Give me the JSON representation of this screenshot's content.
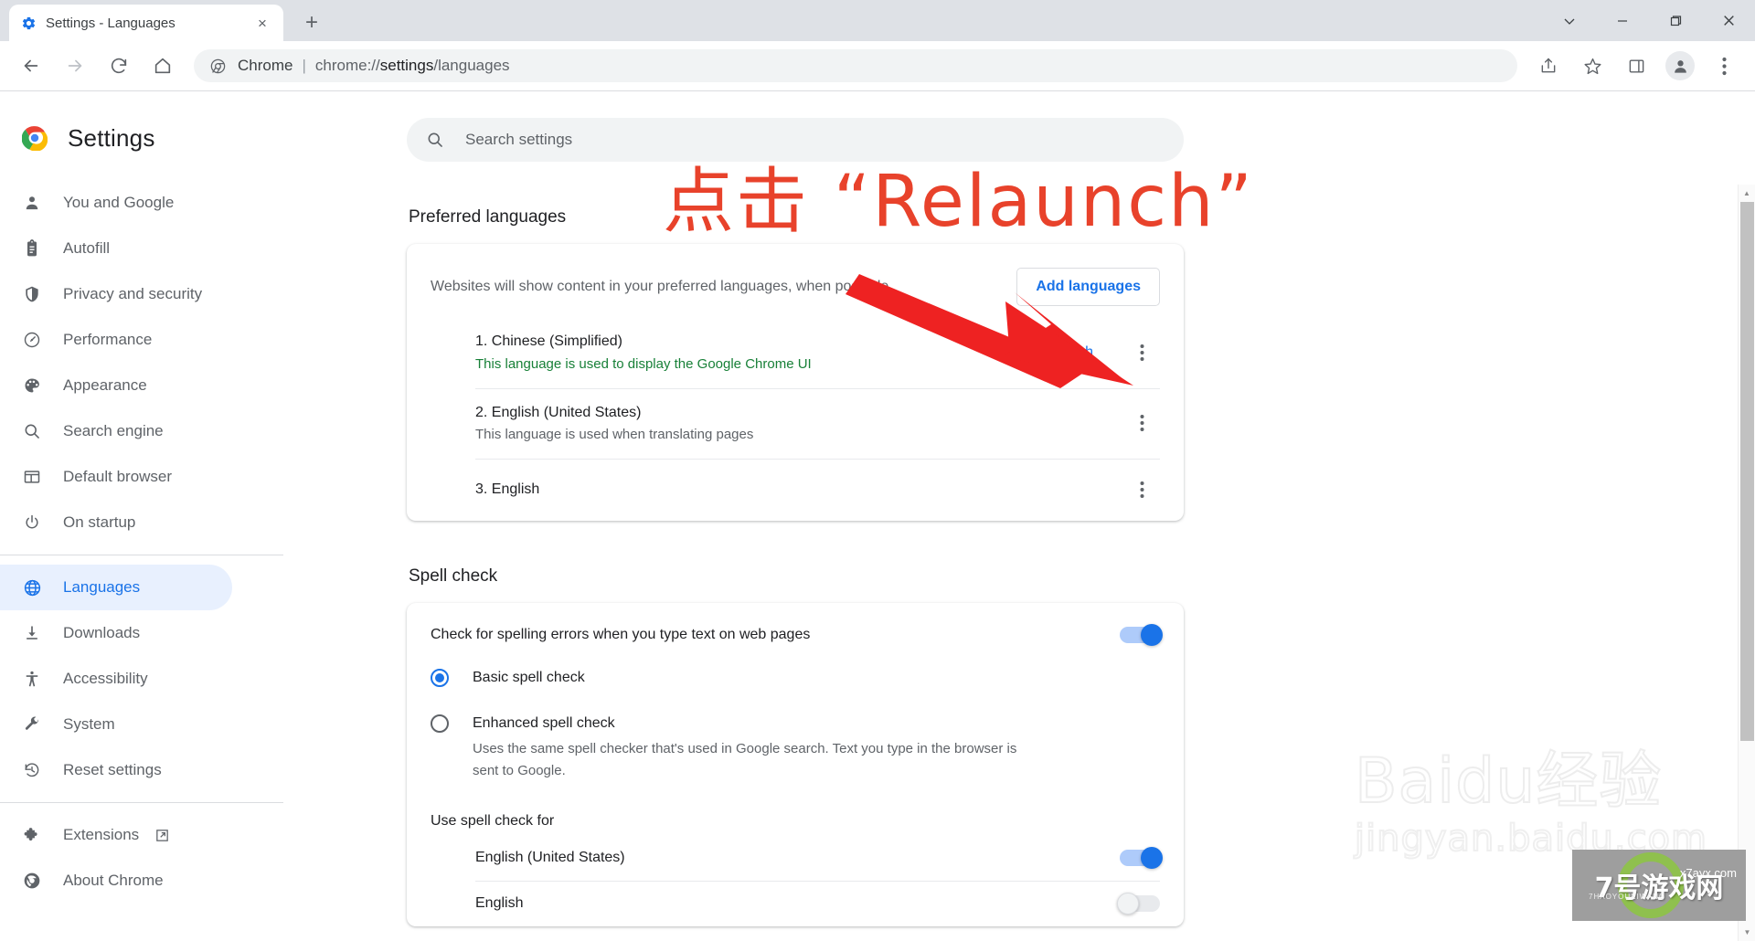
{
  "browser": {
    "tab": {
      "title": "Settings - Languages",
      "favicon": "settings-gear-icon",
      "close": "×"
    },
    "new_tab_label": "+",
    "window_controls": {
      "dropdown": "⌄",
      "minimize": "—",
      "maximize": "❐",
      "close": "✕"
    },
    "omnibox": {
      "chip": "Chrome",
      "separator": "|",
      "url_prefix": "chrome://",
      "url_bold": "settings",
      "url_suffix": "/languages"
    },
    "toolbar_icons": [
      "back-icon",
      "forward-icon",
      "reload-icon",
      "home-icon",
      "share-icon",
      "bookmark-star-icon",
      "side-panel-icon",
      "profile-avatar-icon",
      "chrome-menu-icon"
    ]
  },
  "sidebar": {
    "brand": "Settings",
    "items": [
      {
        "label": "You and Google",
        "icon": "person-icon",
        "active": false
      },
      {
        "label": "Autofill",
        "icon": "clipboard-icon",
        "active": false
      },
      {
        "label": "Privacy and security",
        "icon": "shield-icon",
        "active": false
      },
      {
        "label": "Performance",
        "icon": "speedometer-icon",
        "active": false
      },
      {
        "label": "Appearance",
        "icon": "palette-icon",
        "active": false
      },
      {
        "label": "Search engine",
        "icon": "search-icon",
        "active": false
      },
      {
        "label": "Default browser",
        "icon": "browser-window-icon",
        "active": false
      },
      {
        "label": "On startup",
        "icon": "power-icon",
        "active": false
      },
      {
        "label": "Languages",
        "icon": "globe-icon",
        "active": true
      },
      {
        "label": "Downloads",
        "icon": "download-icon",
        "active": false
      },
      {
        "label": "Accessibility",
        "icon": "accessibility-icon",
        "active": false
      },
      {
        "label": "System",
        "icon": "wrench-icon",
        "active": false
      },
      {
        "label": "Reset settings",
        "icon": "history-restore-icon",
        "active": false
      },
      {
        "label": "Extensions",
        "icon": "puzzle-icon",
        "active": false,
        "external": true
      },
      {
        "label": "About Chrome",
        "icon": "chrome-logo-icon",
        "active": false
      }
    ]
  },
  "search": {
    "placeholder": "Search settings",
    "icon": "search-icon"
  },
  "languages_section": {
    "title": "Preferred languages",
    "description": "Websites will show content in your preferred languages, when possible",
    "add_button": "Add languages",
    "relaunch_button": "Relaunch",
    "rows": [
      {
        "name": "1. Chinese (Simplified)",
        "sub": "This language is used to display the Google Chrome UI",
        "sub_style": "ui"
      },
      {
        "name": "2. English (United States)",
        "sub": "This language is used when translating pages",
        "sub_style": "normal"
      },
      {
        "name": "3. English",
        "sub": "",
        "sub_style": "normal"
      }
    ]
  },
  "spellcheck_section": {
    "title": "Spell check",
    "toggle_label": "Check for spelling errors when you type text on web pages",
    "toggle_on": true,
    "options": [
      {
        "label": "Basic spell check",
        "desc": "",
        "checked": true
      },
      {
        "label": "Enhanced spell check",
        "desc": "Uses the same spell checker that's used in Google search. Text you type in the browser is sent to Google.",
        "checked": false
      }
    ],
    "use_for_label": "Use spell check for",
    "languages": [
      {
        "label": "English (United States)",
        "on": true
      },
      {
        "label": "English",
        "on": false
      }
    ]
  },
  "annotation": {
    "text": "点击 “Relaunch”",
    "color": "#e8422b",
    "arrow": "red-arrow"
  },
  "watermarks": {
    "baidu_main": "Baidu经验",
    "baidu_sub": "jingyan.baidu.com",
    "game_text": "7号游戏网",
    "game_sub": "7HAOYOUXIWANG",
    "game_domain": "x7ayx.com",
    "game_big": "游戏"
  },
  "scrollbar": {
    "up_arrow": "▲",
    "down_arrow": "▼"
  }
}
